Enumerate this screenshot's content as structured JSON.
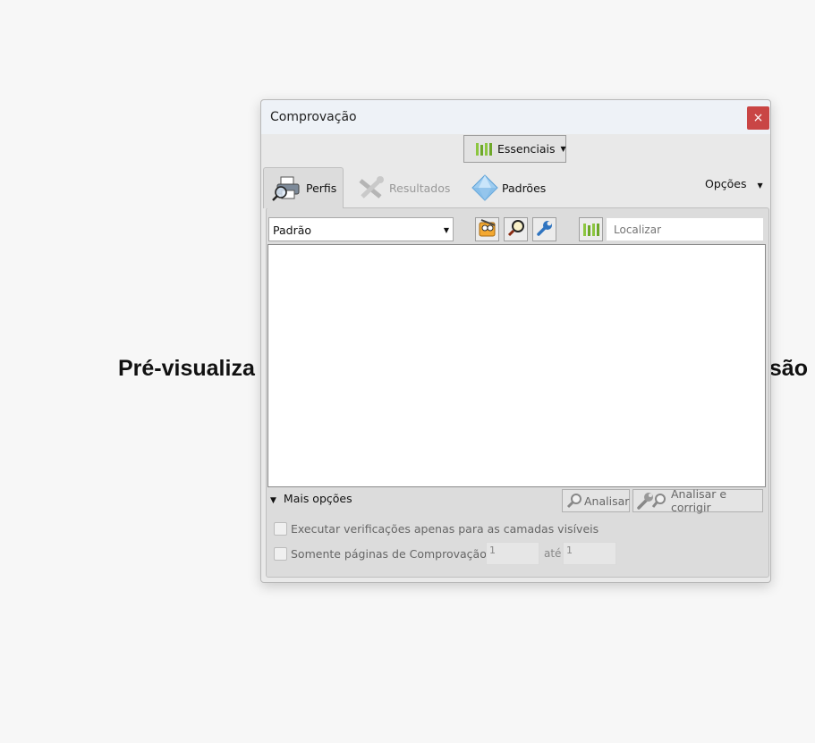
{
  "background": {
    "heading_start": "Pré-visualiza",
    "heading_end": "são"
  },
  "dialog": {
    "title": "Comprovação",
    "close_icon": "×",
    "essenciais_label": "Essenciais",
    "tabs": [
      {
        "label": "Perfis",
        "icon": "printer-magnifier-icon",
        "state": "active"
      },
      {
        "label": "Resultados",
        "icon": "wrench-cross-icon",
        "state": "disabled"
      },
      {
        "label": "Padrões",
        "icon": "diamond-icon",
        "state": "normal"
      }
    ],
    "opcoes_label": "Opções",
    "profile_select_value": "Padrão",
    "search_placeholder": "Localizar",
    "mais_opcoes_label": "Mais opções",
    "analisar_label": "Analisar",
    "analisar_corrigir_label": "Analisar e corrigir",
    "checkbox_visible_layers": "Executar verificações apenas para as camadas visíveis",
    "checkbox_pages": "Somente páginas de Comprovação",
    "page_from": "1",
    "page_to_label": "até",
    "page_to": "1"
  },
  "colors": {
    "close": "#c94545",
    "accent_green": "#8cc63f",
    "wrench_blue": "#2f74c0"
  }
}
